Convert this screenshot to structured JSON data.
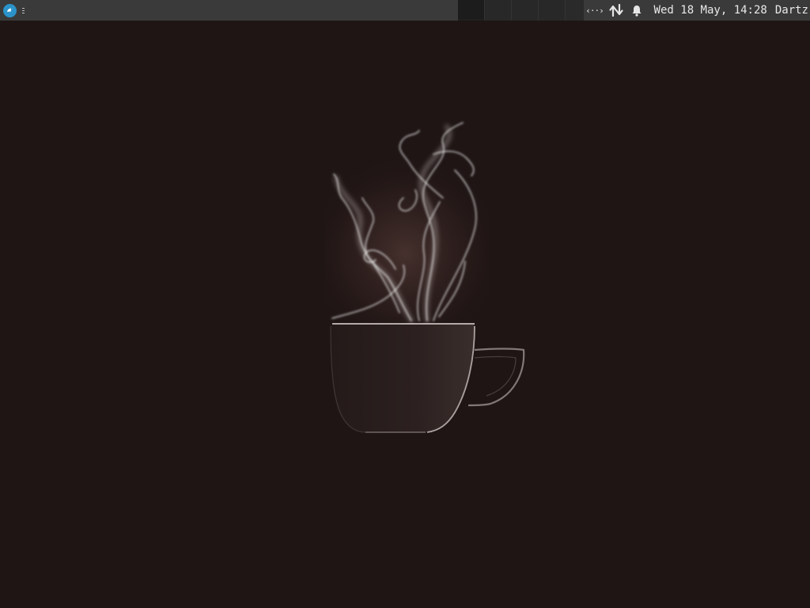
{
  "desktop": {
    "background_color": "#1f1515",
    "wallpaper": "steaming-coffee-cup"
  },
  "panel": {
    "launcher_icon": "distro-logo-icon",
    "workspaces": [
      {
        "index": 1,
        "active": true
      },
      {
        "index": 2,
        "active": false
      },
      {
        "index": 3,
        "active": false
      },
      {
        "index": 4,
        "active": false
      }
    ],
    "tray": {
      "code_icon_glyph": "‹··›",
      "network_icon": "network-arrows-icon",
      "notification_icon": "bell-icon",
      "clock": "Wed 18 May, 14:28",
      "user": "Dartz"
    }
  },
  "colors": {
    "panel_bg": "#3a3a3a",
    "workspace_bg": "#282828",
    "launcher_blue": "#2b93c9",
    "text": "#e8e8e8"
  }
}
